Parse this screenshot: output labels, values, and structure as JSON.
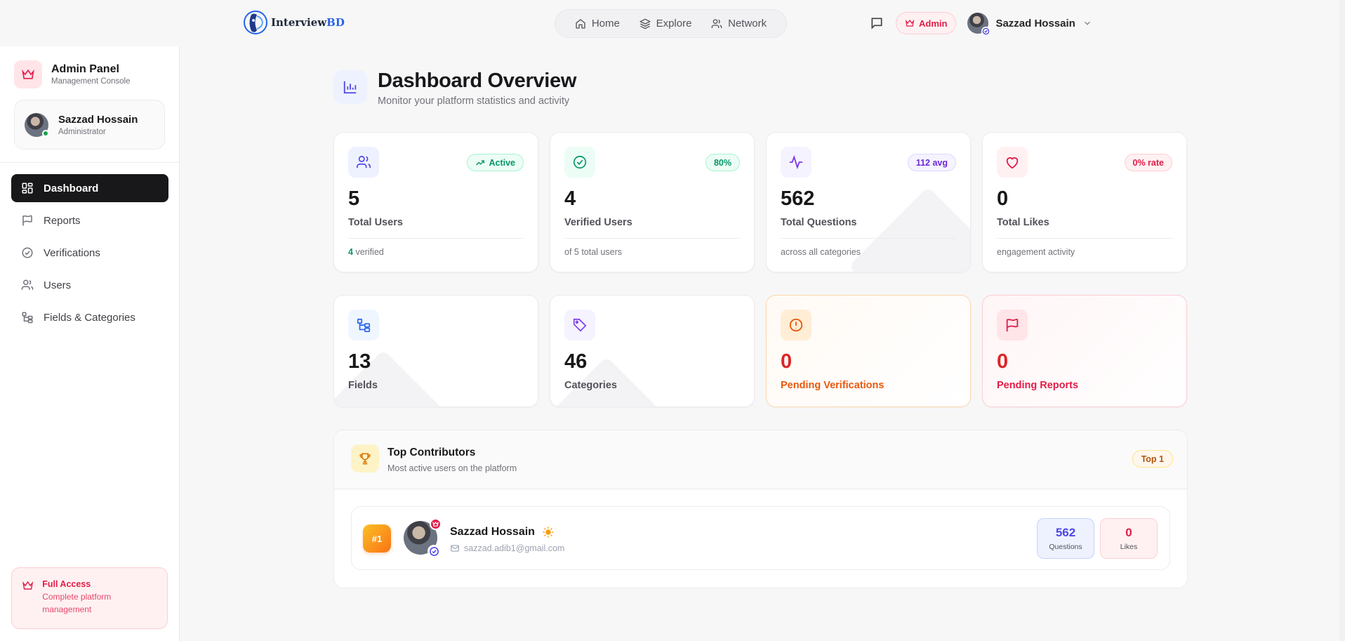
{
  "brand": {
    "name_prefix": "Interview",
    "name_suffix": "BD"
  },
  "nav": {
    "items": [
      {
        "label": "Home",
        "icon": "home-icon"
      },
      {
        "label": "Explore",
        "icon": "layers-icon"
      },
      {
        "label": "Network",
        "icon": "users-icon"
      }
    ]
  },
  "topbar": {
    "admin_label": "Admin",
    "user_name": "Sazzad Hossain"
  },
  "sidebar": {
    "title": "Admin Panel",
    "subtitle": "Management Console",
    "user": {
      "name": "Sazzad Hossain",
      "role": "Administrator"
    },
    "menu": [
      {
        "label": "Dashboard",
        "icon": "grid-icon",
        "active": true
      },
      {
        "label": "Reports",
        "icon": "flag-icon"
      },
      {
        "label": "Verifications",
        "icon": "check-circle-icon"
      },
      {
        "label": "Users",
        "icon": "users-icon"
      },
      {
        "label": "Fields & Categories",
        "icon": "tree-icon"
      }
    ],
    "footer": {
      "title": "Full Access",
      "desc": "Complete platform management"
    }
  },
  "header": {
    "title": "Dashboard Overview",
    "subtitle": "Monitor your platform statistics and activity"
  },
  "stats": [
    {
      "value": "5",
      "label": "Total Users",
      "badge": "Active",
      "foot_value": "4",
      "foot_text": "verified",
      "icon": "users-icon",
      "color": "#6366f1"
    },
    {
      "value": "4",
      "label": "Verified Users",
      "badge": "80%",
      "foot_text": "of 5 total users",
      "icon": "check-circle-icon",
      "color": "#059669"
    },
    {
      "value": "562",
      "label": "Total Questions",
      "badge": "112 avg",
      "foot_text": "across all categories",
      "icon": "activity-icon",
      "color": "#7c3aed"
    },
    {
      "value": "0",
      "label": "Total Likes",
      "badge": "0% rate",
      "foot_text": "engagement activity",
      "icon": "heart-icon",
      "color": "#e11d48"
    }
  ],
  "stats2": [
    {
      "value": "13",
      "label": "Fields",
      "icon": "tree-icon"
    },
    {
      "value": "46",
      "label": "Categories",
      "icon": "tag-icon"
    },
    {
      "value": "0",
      "label": "Pending Verifications",
      "icon": "alert-circle-icon"
    },
    {
      "value": "0",
      "label": "Pending Reports",
      "icon": "flag-icon"
    }
  ],
  "contributors": {
    "title": "Top Contributors",
    "subtitle": "Most active users on the platform",
    "badge": "Top 1",
    "rows": [
      {
        "rank": "#1",
        "name": "Sazzad Hossain",
        "email": "sazzad.adib1@gmail.com",
        "questions": "562",
        "questions_label": "Questions",
        "likes": "0",
        "likes_label": "Likes"
      }
    ]
  }
}
